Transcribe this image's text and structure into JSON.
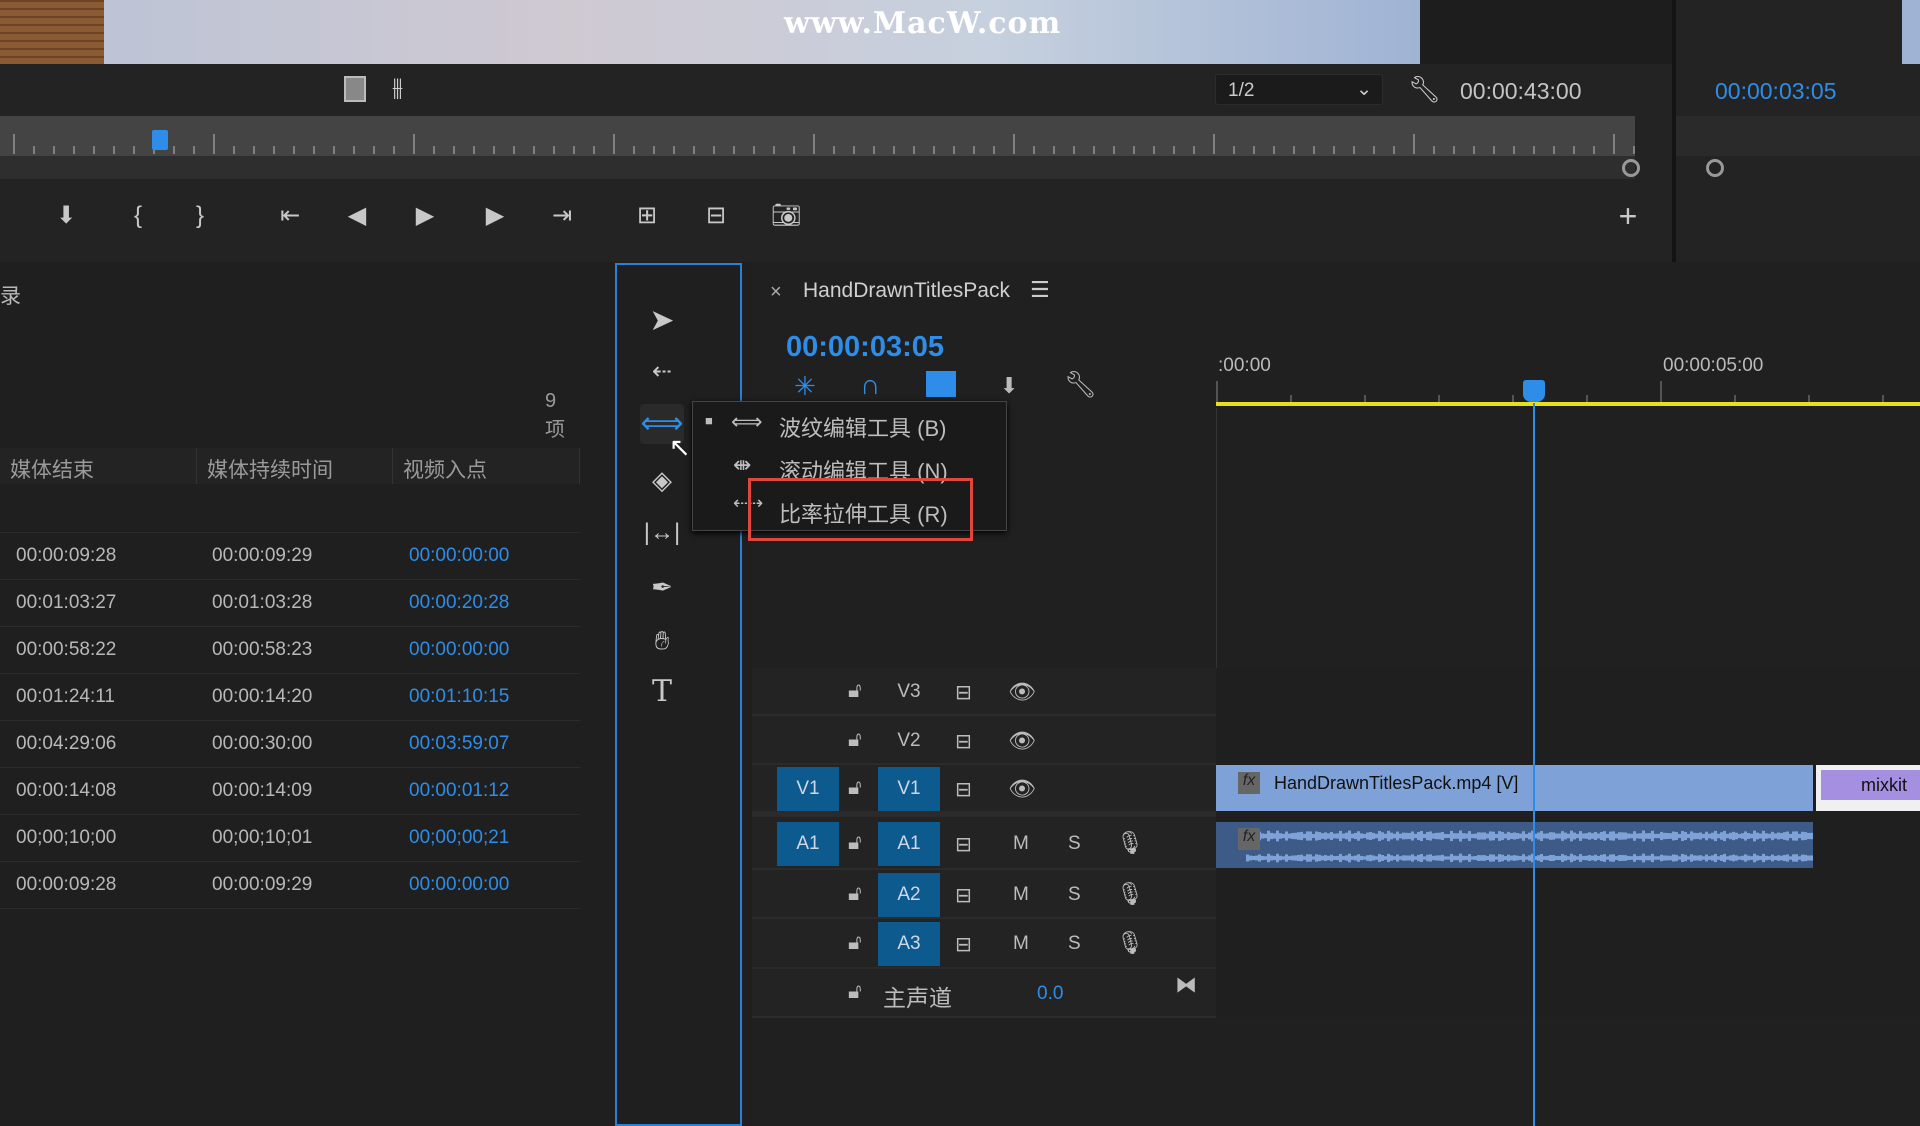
{
  "viewer": {
    "watermark": "www.MacW.com",
    "zoom_select": "1/2",
    "duration": "00:00:43:00",
    "transport": [
      "marker",
      "mark-in",
      "mark-out",
      "go-to-in",
      "step-back",
      "play",
      "step-forward",
      "go-to-out",
      "insert",
      "overwrite",
      "export-frame"
    ]
  },
  "program": {
    "timecode": "00:00:03:05"
  },
  "project": {
    "title_fragment": "录",
    "count": "9 项",
    "columns": [
      "媒体结束",
      "媒体持续时间",
      "视频入点"
    ],
    "rows": [
      [
        "00:00:09:28",
        "00:00:09:29",
        "00:00:00:00"
      ],
      [
        "00:01:03:27",
        "00:01:03:28",
        "00:00:20:28"
      ],
      [
        "00:00:58:22",
        "00:00:58:23",
        "00:00:00:00"
      ],
      [
        "00:01:24:11",
        "00:00:14:20",
        "00:01:10:15"
      ],
      [
        "00:04:29:06",
        "00:00:30:00",
        "00:03:59:07"
      ],
      [
        "00:00:14:08",
        "00:00:14:09",
        "00:00:01:12"
      ],
      [
        "00;00;10;00",
        "00;00;10;01",
        "00;00;00;21"
      ],
      [
        "00:00:09:28",
        "00:00:09:29",
        "00:00:00:00"
      ]
    ]
  },
  "flyout": {
    "items": [
      {
        "label": "波纹编辑工具 (B)",
        "selected": true
      },
      {
        "label": "滚动编辑工具 (N)",
        "selected": false
      },
      {
        "label": "比率拉伸工具 (R)",
        "selected": false,
        "highlighted": true
      }
    ]
  },
  "timeline": {
    "close": "×",
    "sequence": "HandDrawnTitlesPack",
    "timecode": "00:00:03:05",
    "ruler": [
      ":00:00",
      "00:00:05:00"
    ],
    "tracks": {
      "v3": "V3",
      "v2": "V2",
      "v1": "V1",
      "v1src": "V1",
      "a1": "A1",
      "a1src": "A1",
      "a2": "A2",
      "a3": "A3",
      "m": "M",
      "s": "S",
      "master": "主声道",
      "master_value": "0.0"
    },
    "clips": {
      "video": "HandDrawnTitlesPack.mp4 [V]",
      "next": "mixkit",
      "fx": "fx"
    }
  },
  "colors": {
    "accent": "#2e8de8",
    "playhead": "#2e8de8",
    "work_area": "#e8e01e",
    "highlight_box": "#e0463c",
    "clip_video": "#7ea2d8"
  }
}
